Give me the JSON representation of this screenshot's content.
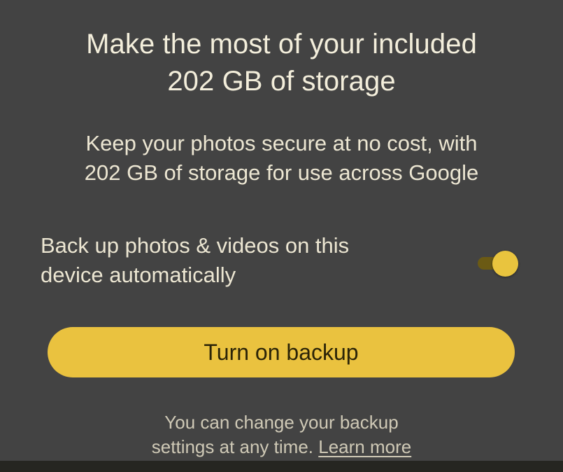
{
  "header": {
    "title_line1": "Make the most of your included",
    "title_line2": "202 GB of storage"
  },
  "description": {
    "line1": "Keep your photos secure at no cost, with",
    "line2": "202 GB of storage for use across Google"
  },
  "backup_toggle": {
    "label_line1": "Back up photos & videos on this",
    "label_line2": "device automatically",
    "state": "on",
    "accent_color": "#eac23f"
  },
  "primary_action": {
    "label": "Turn on backup"
  },
  "footer": {
    "line1": "You can change your backup",
    "line2_prefix": "settings at any time.",
    "learn_more_link": "Learn more"
  },
  "colors": {
    "background": "#434343",
    "button_fill": "#eac23f",
    "text": "#f1ecd9"
  }
}
